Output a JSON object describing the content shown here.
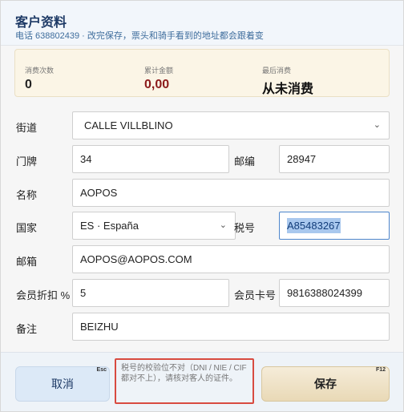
{
  "header": {
    "title": "客户资料",
    "subtitle": "电话 638802439 · 改完保存，票头和骑手看到的地址都会跟着变"
  },
  "stats": {
    "visits_label": "消费次数",
    "visits_value": "0",
    "total_label": "累计金额",
    "total_value": "0,00",
    "last_label": "最后消费",
    "last_value": "从未消费"
  },
  "form": {
    "street_label": "街道",
    "street_value": "CALLE VILLBLINO",
    "door_label": "门牌",
    "door_value": "34",
    "postal_label": "邮编",
    "postal_value": "28947",
    "name_label": "名称",
    "name_value": "AOPOS",
    "country_label": "国家",
    "country_value": "ES · España",
    "tax_label": "税号",
    "tax_value": "A85483267",
    "email_label": "邮箱",
    "email_value": "AOPOS@AOPOS.COM",
    "discount_label": "会员折扣 %",
    "discount_value": "5",
    "card_label": "会员卡号",
    "card_value": "9816388024399",
    "note_label": "备注",
    "note_value": "BEIZHU"
  },
  "footer": {
    "cancel_label": "取消",
    "cancel_key": "Esc",
    "warning": "税号的校验位不对（DNI / NIE / CIF 都对不上），请核对客人的证件。",
    "save_label": "保存",
    "save_key": "F12"
  },
  "icons": {
    "dropdown": "chevron-down-icon"
  },
  "colors": {
    "title": "#1e3a66",
    "total_value": "#8b1a1a",
    "selection": "#a9c8ee",
    "warning_border": "#d84b40",
    "save_button": "#e9d9b6"
  }
}
